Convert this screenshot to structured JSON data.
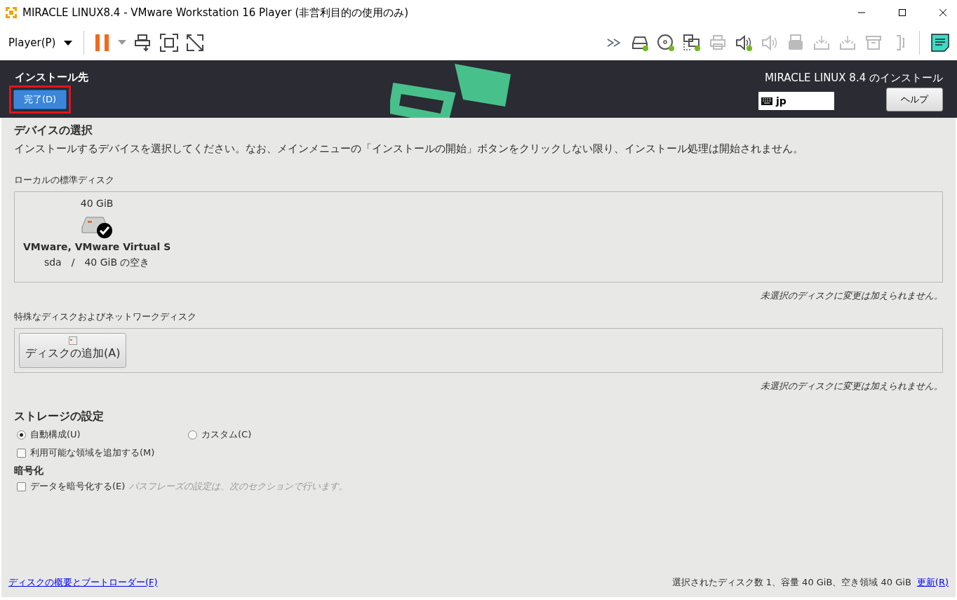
{
  "window": {
    "title": "MIRACLE LINUX8.4 - VMware Workstation 16 Player (非営利目的の使用のみ)"
  },
  "toolbar": {
    "player_menu": "Player(P)",
    "devices": [
      {
        "kind": "disk",
        "connected": true,
        "disabled": false
      },
      {
        "kind": "cd",
        "connected": true,
        "disabled": false
      },
      {
        "kind": "network",
        "connected": true,
        "disabled": false
      },
      {
        "kind": "printer",
        "connected": false,
        "disabled": true
      },
      {
        "kind": "sound",
        "connected": true,
        "disabled": false
      },
      {
        "kind": "sound",
        "connected": false,
        "disabled": true
      },
      {
        "kind": "usb",
        "connected": false,
        "disabled": true
      },
      {
        "kind": "usb-arrow",
        "connected": false,
        "disabled": true
      },
      {
        "kind": "usb-arrow",
        "connected": false,
        "disabled": true
      },
      {
        "kind": "box",
        "connected": false,
        "disabled": true
      },
      {
        "kind": "bracket",
        "connected": false,
        "disabled": true
      }
    ]
  },
  "header": {
    "section_title": "インストール先",
    "done_button": {
      "label": "完了(D)",
      "highlighted": true
    },
    "product": "MIRACLE LINUX 8.4 のインストール",
    "keyboard": "jp",
    "help_button": "ヘルプ"
  },
  "device_selection": {
    "heading": "デバイスの選択",
    "description": "インストールするデバイスを選択してください。なお、メインメニューの「インストールの開始」ボタンをクリックしない限り、インストール処理は開始されません。"
  },
  "local_disks": {
    "label": "ローカルの標準ディスク",
    "disks": [
      {
        "size": "40 GiB",
        "name": "VMware, VMware Virtual S",
        "device": "sda",
        "separator": "/",
        "free": "40 GiB の空き",
        "selected": true
      }
    ],
    "note": "未選択のディスクに変更は加えられません。"
  },
  "special_disks": {
    "label": "特殊なディスクおよびネットワークディスク",
    "add_button": "ディスクの追加(A)",
    "note": "未選択のディスクに変更は加えられません。"
  },
  "storage": {
    "heading": "ストレージの設定",
    "options": [
      {
        "label": "自動構成(U)",
        "selected": true
      },
      {
        "label": "カスタム(C)",
        "selected": false
      }
    ],
    "reclaim": {
      "label": "利用可能な領域を追加する(M)",
      "checked": false
    }
  },
  "encryption": {
    "heading": "暗号化",
    "checkbox": {
      "label": "データを暗号化する(E)",
      "checked": false
    },
    "hint": "パスフレーズの設定は、次のセクションで行います。"
  },
  "footer": {
    "link": "ディスクの概要とブートローダー(F)",
    "summary": "選択されたディスク数 1、容量 40 GiB、空き領域 40 GiB",
    "refresh": "更新(R)"
  }
}
